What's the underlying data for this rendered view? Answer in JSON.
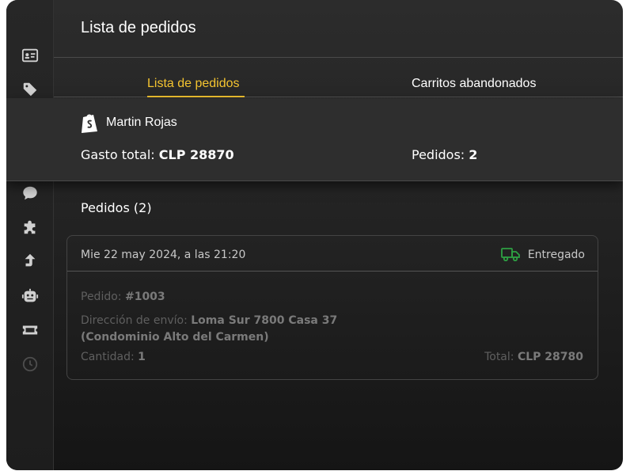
{
  "page": {
    "title": "Lista de pedidos"
  },
  "tabs": [
    {
      "label": "Lista de pedidos",
      "active": true
    },
    {
      "label": "Carritos abandonados",
      "active": false
    }
  ],
  "customer": {
    "name": "Martin Rojas",
    "spent_label": "Gasto total:",
    "spent_value": "CLP 28870",
    "orders_label": "Pedidos:",
    "orders_value": "2"
  },
  "orders_section": {
    "title": "Pedidos (2)"
  },
  "order": {
    "date": "Mie 22 may 2024, a las 21:20",
    "status": "Entregado",
    "status_color": "#2ea043",
    "number_label": "Pedido:",
    "number_value": "#1003",
    "address_label": "Dirección de envío:",
    "address_line1": "Loma Sur 7800 Casa 37",
    "address_line2": "(Condominio Alto del Carmen)",
    "qty_label": "Cantidad:",
    "qty_value": "1",
    "total_label": "Total:",
    "total_value": "CLP 28780"
  },
  "sidebar_icons": [
    "contact-card-icon",
    "tag-icon",
    "shopping-bag-icon",
    "users-icon",
    "chat-bubble-icon",
    "puzzle-icon",
    "upload-arrow-icon",
    "robot-icon",
    "ticket-icon",
    "clock-icon"
  ],
  "colors": {
    "accent": "#f4c430",
    "background": "#222222"
  }
}
